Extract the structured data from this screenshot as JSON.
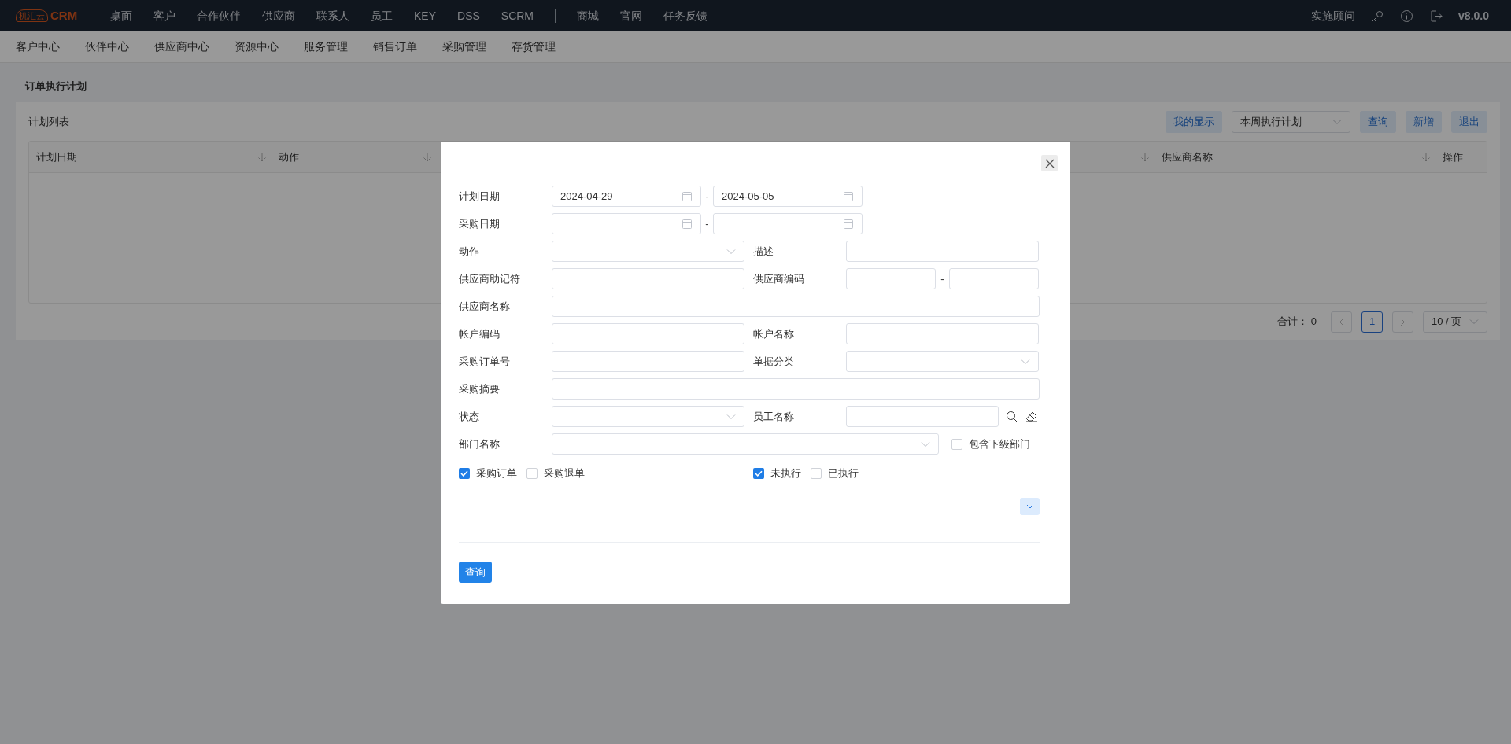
{
  "top_nav": {
    "logo": {
      "badge": "机汇云",
      "text": "CRM"
    },
    "items": [
      {
        "label": "桌面"
      },
      {
        "label": "客户"
      },
      {
        "label": "合作伙伴"
      },
      {
        "label": "供应商"
      },
      {
        "label": "联系人"
      },
      {
        "label": "员工"
      },
      {
        "label": "KEY"
      },
      {
        "label": "DSS"
      },
      {
        "label": "SCRM"
      }
    ],
    "extra_items": [
      {
        "label": "商城"
      },
      {
        "label": "官网"
      },
      {
        "label": "任务反馈"
      }
    ],
    "user": "实施顾问",
    "version": "v8.0.0"
  },
  "sub_nav": [
    {
      "label": "客户中心"
    },
    {
      "label": "伙伴中心"
    },
    {
      "label": "供应商中心"
    },
    {
      "label": "资源中心"
    },
    {
      "label": "服务管理"
    },
    {
      "label": "销售订单"
    },
    {
      "label": "采购管理"
    },
    {
      "label": "存货管理"
    }
  ],
  "page": {
    "title": "订单执行计划",
    "list_title": "计划列表",
    "toolbar": {
      "view_button": "我的显示",
      "plan_select": "本周执行计划",
      "buttons": [
        "查询",
        "新增",
        "退出"
      ]
    },
    "table": {
      "columns": [
        {
          "label": "计划日期"
        },
        {
          "label": "动作"
        },
        {
          "label": "供应商名称"
        },
        {
          "label": "操作"
        }
      ]
    },
    "pagination": {
      "total_label": "合计：",
      "total": "0",
      "pages": [
        {
          "label": "1",
          "selected": true
        }
      ],
      "page_size": "10 / 页"
    }
  },
  "dialog": {
    "rows": [
      [
        {
          "label": "计划日期",
          "kind": "date_range",
          "separator": "-",
          "values": [
            "2024-04-29",
            "2024-05-05"
          ]
        }
      ],
      [
        {
          "label": "采购日期",
          "kind": "date_range",
          "separator": "-"
        }
      ],
      [
        {
          "label": "动作",
          "kind": "select"
        },
        {
          "label": "描述",
          "kind": "text"
        }
      ],
      [
        {
          "label": "供应商助记符",
          "kind": "text"
        },
        {
          "label": "供应商编码",
          "kind": "range",
          "separator": "-"
        }
      ],
      [
        {
          "label": "供应商名称",
          "kind": "text"
        }
      ],
      [
        {
          "label": "帐户编码",
          "kind": "text"
        },
        {
          "label": "帐户名称",
          "kind": "text"
        }
      ],
      [
        {
          "label": "采购订单号",
          "kind": "text"
        },
        {
          "label": "单据分类",
          "kind": "select"
        }
      ],
      [
        {
          "label": "采购摘要",
          "kind": "text"
        }
      ],
      [
        {
          "label": "状态",
          "kind": "select"
        },
        {
          "label": "员工名称",
          "kind": "lookup"
        }
      ],
      [
        {
          "label": "部门名称",
          "kind": "select",
          "option": {
            "label": "包含下级部门",
            "checked": false
          }
        }
      ]
    ],
    "check_groups": [
      [
        {
          "label": "采购订单",
          "checked": true
        },
        {
          "label": "采购退单",
          "checked": false
        }
      ],
      [
        {
          "label": "未执行",
          "checked": true
        },
        {
          "label": "已执行",
          "checked": false
        }
      ]
    ],
    "submit": "查询"
  }
}
